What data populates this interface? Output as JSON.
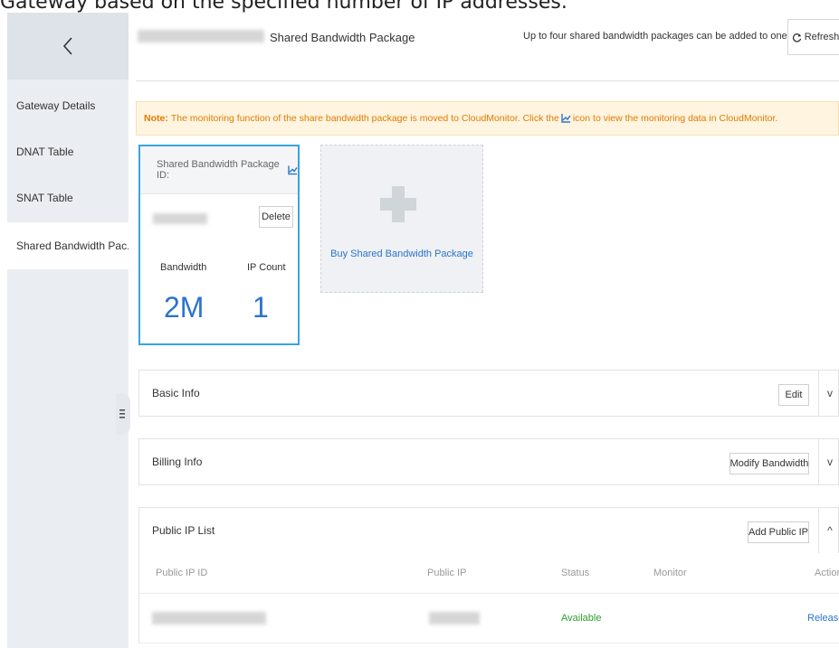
{
  "caption": "Gateway based on the specified number of IP addresses.",
  "sidebar": {
    "items": [
      {
        "label": "Gateway Details"
      },
      {
        "label": "DNAT Table"
      },
      {
        "label": "SNAT Table"
      },
      {
        "label": "Shared Bandwidth Pac..."
      }
    ]
  },
  "header": {
    "title": "Shared Bandwidth Package",
    "note": "Up to four shared bandwidth packages can be added to one gateway.",
    "refresh_label": "Refresh"
  },
  "notice": {
    "prefix": "Note:",
    "text_before_icon": "The monitoring function of the share bandwidth package is moved to CloudMonitor. Click the",
    "text_after_icon": "icon to view the monitoring data in CloudMonitor."
  },
  "package_card": {
    "id_label": "Shared Bandwidth Package ID:",
    "delete_label": "Delete",
    "bandwidth_label": "Bandwidth",
    "bandwidth_value": "2M",
    "ip_count_label": "IP Count",
    "ip_count_value": "1"
  },
  "buy_card": {
    "label": "Buy Shared Bandwidth Package"
  },
  "panels": {
    "basic": {
      "title": "Basic Info",
      "button": "Edit",
      "chevron": "v"
    },
    "billing": {
      "title": "Billing Info",
      "button": "Modify Bandwidth",
      "chevron": "v"
    },
    "public_ip": {
      "title": "Public IP List",
      "button": "Add Public IP",
      "chevron": "^"
    }
  },
  "table": {
    "headers": [
      "Public IP ID",
      "Public IP",
      "Status",
      "Monitor",
      "Actions"
    ],
    "rows": [
      {
        "status": "Available",
        "action": "Release"
      }
    ]
  },
  "colors": {
    "accent": "#2a74cc",
    "status_ok": "#2e9e2e",
    "warning": "#e07b00",
    "card_border": "#3aa4e0"
  }
}
